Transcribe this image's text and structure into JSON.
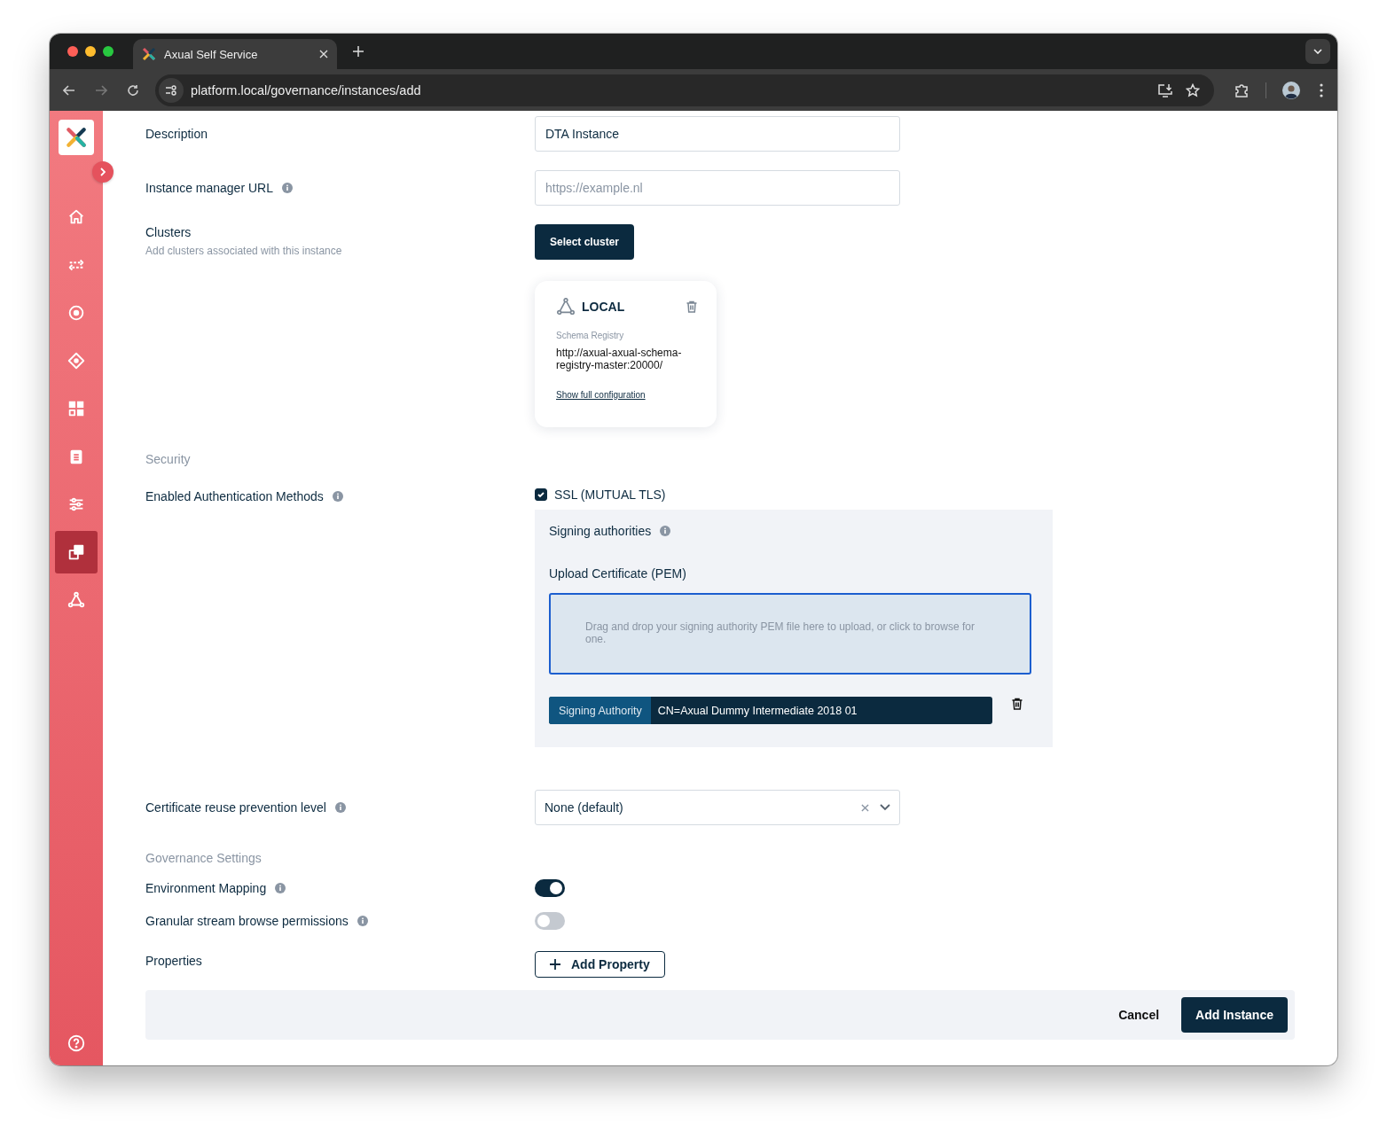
{
  "browser": {
    "tab_title": "Axual Self Service",
    "url": "platform.local/governance/instances/add"
  },
  "sidebar": {
    "items": [
      {
        "kind": "home",
        "selected": false
      },
      {
        "kind": "arrows",
        "selected": false
      },
      {
        "kind": "target",
        "selected": false
      },
      {
        "kind": "diamond",
        "selected": false
      },
      {
        "kind": "grid",
        "selected": false
      },
      {
        "kind": "clipboard",
        "selected": false
      },
      {
        "kind": "sliders",
        "selected": false
      },
      {
        "kind": "copy",
        "selected": true
      },
      {
        "kind": "network",
        "selected": false
      }
    ]
  },
  "form": {
    "description": {
      "label": "Description",
      "value": "DTA Instance"
    },
    "manager_url": {
      "label": "Instance manager URL",
      "placeholder": "https://example.nl"
    },
    "clusters": {
      "label": "Clusters",
      "hint": "Add clusters associated with this instance",
      "button": "Select cluster",
      "cards": [
        {
          "name": "LOCAL",
          "registry_label": "Schema Registry",
          "registry_url": "http://axual-axual-schema-registry-master:20000/",
          "link": "Show full configuration"
        }
      ]
    },
    "security_title": "Security",
    "auth": {
      "label": "Enabled Authentication Methods",
      "methods": [
        {
          "label": "SSL (MUTUAL TLS)",
          "checked": true
        }
      ],
      "panel": {
        "title": "Signing authorities",
        "upload_label": "Upload Certificate (PEM)",
        "dropzone_text": "Drag and drop your signing authority PEM file here to upload, or click to browse for one.",
        "certificates": [
          {
            "tag": "Signing Authority",
            "value": "CN=Axual Dummy Intermediate 2018 01"
          }
        ]
      }
    },
    "reuse": {
      "label": "Certificate reuse prevention level",
      "value": "None (default)"
    },
    "governance_title": "Governance Settings",
    "toggles": [
      {
        "label": "Environment Mapping",
        "on": true
      },
      {
        "label": "Granular stream browse permissions",
        "on": false
      }
    ],
    "properties": {
      "label": "Properties",
      "button": "Add Property"
    }
  },
  "footer": {
    "cancel": "Cancel",
    "submit": "Add Instance"
  }
}
